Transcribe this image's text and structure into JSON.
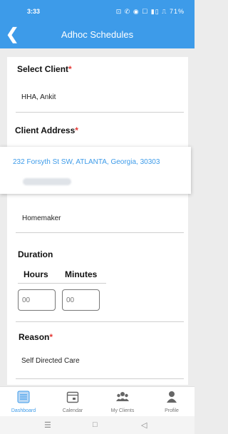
{
  "status_bar": {
    "time": "3:33",
    "icons": "⊡ ✆ ◉ ☐ ▮▯ ⎍ 71%"
  },
  "app_bar": {
    "title": "Adhoc Schedules"
  },
  "form": {
    "client_label": "Select Client",
    "client_value": "HHA, Ankit",
    "address_label": "Client Address",
    "address_value": "232 Forsyth St SW, ATLANTA, Georgia, 30303",
    "service_value": "Homemaker",
    "duration_label": "Duration",
    "hours_label": "Hours",
    "minutes_label": "Minutes",
    "hours_placeholder": "00",
    "minutes_placeholder": "00",
    "reason_label": "Reason",
    "reason_value": "Self Directed Care"
  },
  "bottom_nav": {
    "items": [
      {
        "label": "Dashboard",
        "icon": "dashboard-icon",
        "active": true
      },
      {
        "label": "Calendar",
        "icon": "calendar-icon",
        "active": false
      },
      {
        "label": "My Clients",
        "icon": "clients-icon",
        "active": false
      },
      {
        "label": "Profile",
        "icon": "profile-icon",
        "active": false
      }
    ]
  },
  "colors": {
    "primary": "#3d9be9",
    "required": "#e53935",
    "link": "#3d9be9"
  }
}
